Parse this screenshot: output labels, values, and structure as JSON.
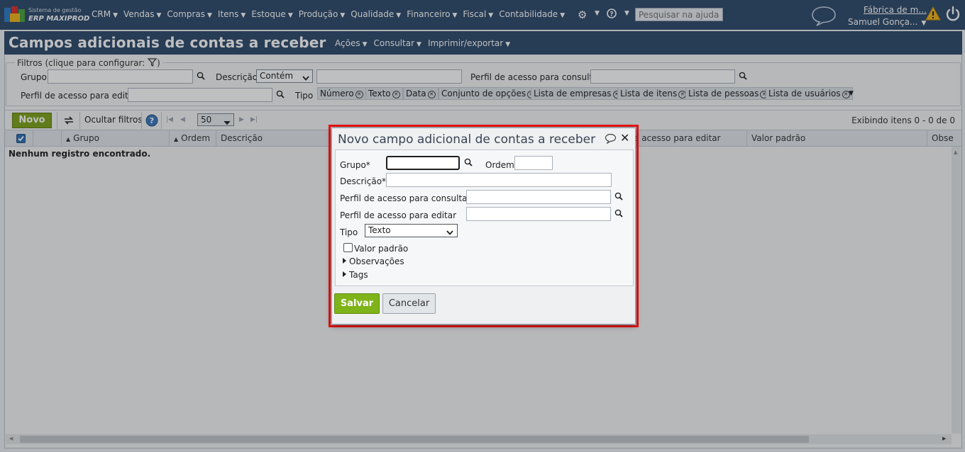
{
  "brand": {
    "line1": "Sistema de gestão",
    "line2": "ERP MAXIPROD"
  },
  "menu": [
    "CRM",
    "Vendas",
    "Compras",
    "Itens",
    "Estoque",
    "Produção",
    "Qualidade",
    "Financeiro",
    "Fiscal",
    "Contabilidade"
  ],
  "top_right": {
    "help_placeholder": "Pesquisar na ajuda...",
    "company": "Fábrica de m...",
    "user": "Samuel Gonça..."
  },
  "page": {
    "title": "Campos adicionais de contas a receber",
    "title_menu": [
      "Ações",
      "Consultar",
      "Imprimir/exportar"
    ]
  },
  "filters": {
    "legend": "Filtros (clique para configurar:",
    "legend_close": ")",
    "grupo_label": "Grupo",
    "descricao_label": "Descrição",
    "descricao_mode": "Contém",
    "perfil_consultar_label": "Perfil de acesso para consultar",
    "perfil_editar_label": "Perfil de acesso para editar",
    "tipo_label": "Tipo",
    "tipo_chips": [
      "Número",
      "Texto",
      "Data",
      "Conjunto de opções",
      "Lista de empresas",
      "Lista de itens",
      "Lista de pessoas",
      "Lista de usuários"
    ]
  },
  "toolbar": {
    "novo": "Novo",
    "hide_filters": "Ocultar filtros",
    "page_size": "50",
    "showing": "Exibindo itens 0 - 0 de 0"
  },
  "grid": {
    "columns": [
      "Grupo",
      "Ordem",
      "Descrição",
      "e acesso para editar",
      "Valor padrão",
      "Obse"
    ],
    "empty": "Nenhum registro encontrado."
  },
  "dialog": {
    "title": "Novo campo adicional de contas a receber",
    "grupo_label": "Grupo*",
    "ordem_label": "Ordem",
    "descricao_label": "Descrição*",
    "perfil_consultar_label": "Perfil de acesso para consultar",
    "perfil_editar_label": "Perfil de acesso para editar",
    "tipo_label": "Tipo",
    "tipo_value": "Texto",
    "valor_padrao_label": "Valor padrão",
    "observacoes_label": "Observações",
    "tags_label": "Tags",
    "save": "Salvar",
    "cancel": "Cancelar"
  },
  "colors": {
    "nav_bg": "#2e4a6b",
    "accent_green": "#7fb31a",
    "highlight_red": "#ee1111"
  }
}
